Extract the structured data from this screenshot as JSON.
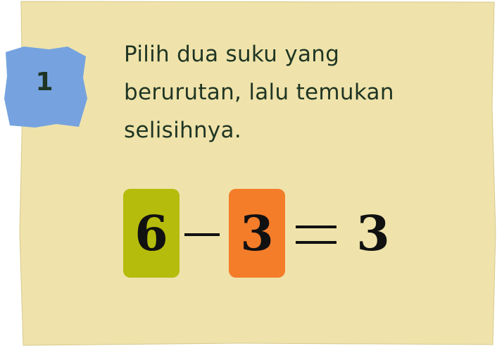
{
  "badge": {
    "number": "1"
  },
  "instruction": "Pilih dua suku yang berurutan, lalu temukan selisihnya.",
  "equation": {
    "term1": "6",
    "term2": "3",
    "result": "3"
  },
  "colors": {
    "card": "#efe3ab",
    "badge": "#76a3df",
    "term1_box": "#b5bc0b",
    "term2_box": "#f47d2a",
    "text": "#1f3523"
  }
}
